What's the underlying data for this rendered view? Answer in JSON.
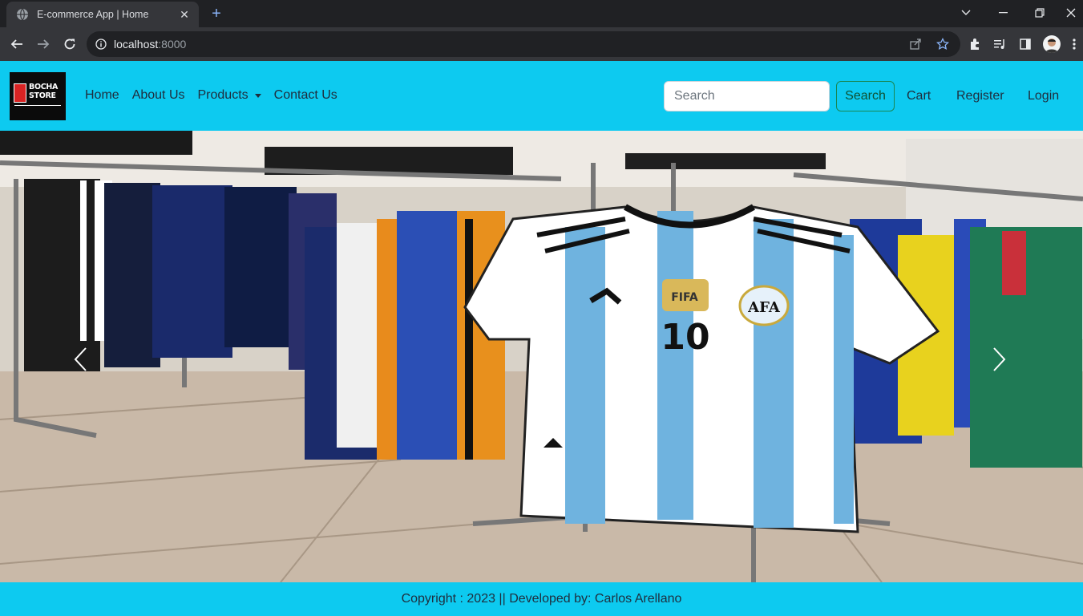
{
  "browser": {
    "tab_title": "E-commerce App | Home",
    "url_host": "localhost",
    "url_port": ":8000",
    "icons": [
      "globe-icon",
      "close-icon",
      "plus-icon",
      "back-icon",
      "forward-icon",
      "reload-icon",
      "info-icon",
      "share-icon",
      "star-icon",
      "extensions-icon",
      "media-icon",
      "sidepanel-icon",
      "avatar",
      "menu-icon"
    ]
  },
  "brand": {
    "line1": "BOCHA",
    "line2": "STORE"
  },
  "nav": {
    "home": "Home",
    "about": "About Us",
    "products": "Products",
    "contact": "Contact Us"
  },
  "search": {
    "placeholder": "Search",
    "button": "Search"
  },
  "user_links": {
    "cart": "Cart",
    "register": "Register",
    "login": "Login"
  },
  "carousel": {
    "jersey_number": "10",
    "jersey_badge": "AFA"
  },
  "footer": {
    "text": "Copyright : 2023 || Developed by: Carlos Arellano"
  },
  "colors": {
    "navbar": "#0dcaf0",
    "chrome_dark": "#202124",
    "chrome_toolbar": "#35363a"
  }
}
